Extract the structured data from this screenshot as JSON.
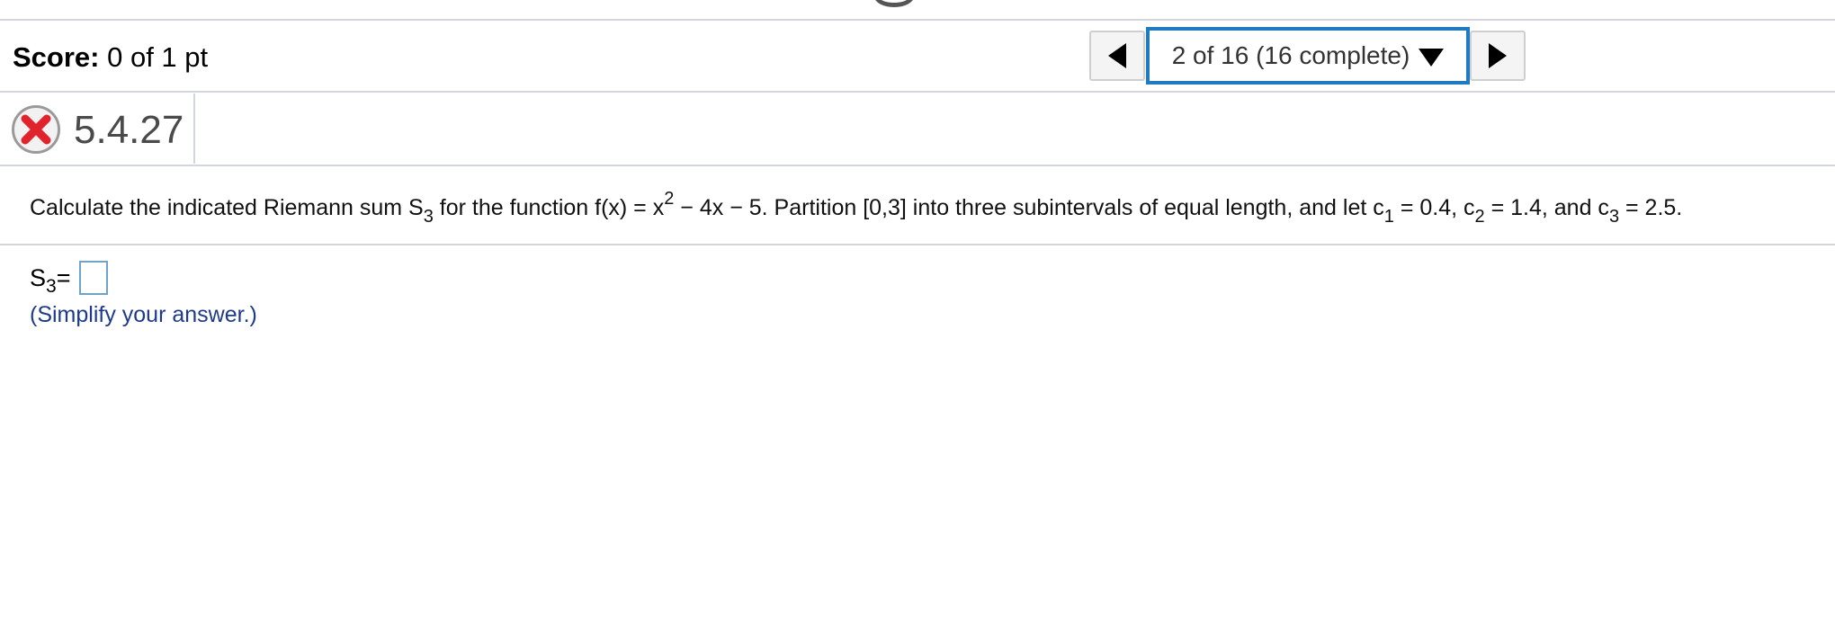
{
  "header": {
    "score_label": "Score:",
    "score_value": "0 of 1 pt",
    "question_selector": "2 of 16 (16 complete)",
    "prev_icon": "triangle-left-icon",
    "next_icon": "triangle-right-icon",
    "dropdown_icon": "triangle-down-icon"
  },
  "question": {
    "status_icon": "red-x-incorrect-icon",
    "id": "5.4.27",
    "text": {
      "t1": "Calculate the indicated Riemann sum S",
      "s_sub": "3",
      "t2": " for the function f(x) = x",
      "pow": "2",
      "t3": " − 4x − 5. Partition [0,3] into three subintervals of equal length, and let c",
      "c1_sub": "1",
      "t4": " = 0.4, c",
      "c2_sub": "2",
      "t5": " = 1.4, and c",
      "c3_sub": "3",
      "t6": " = 2.5."
    },
    "answer": {
      "label": "S",
      "label_sub": "3",
      "equals": " =",
      "value": ""
    },
    "hint": "(Simplify your answer.)"
  },
  "colors": {
    "accent_border": "#1f7bc1",
    "incorrect_red": "#e0232d",
    "hint_text": "#1e3a8a",
    "divider": "#d3d6df"
  }
}
